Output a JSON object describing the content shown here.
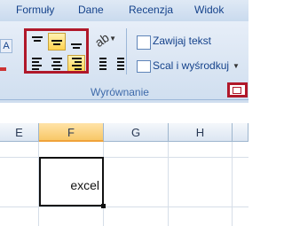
{
  "tabs": [
    "Formuły",
    "Dane",
    "Recenzja",
    "Widok"
  ],
  "ribbon": {
    "wrap_text_label": "Zawijaj tekst",
    "merge_center_label": "Scal i wyśrodkuj",
    "group_label": "Wyrównanie"
  },
  "sheet": {
    "columns": [
      "E",
      "F",
      "G",
      "H"
    ],
    "active_column": "F",
    "cell_value": "excel"
  },
  "colors": {
    "highlight": "#b0182a",
    "accent": "#15428b"
  }
}
